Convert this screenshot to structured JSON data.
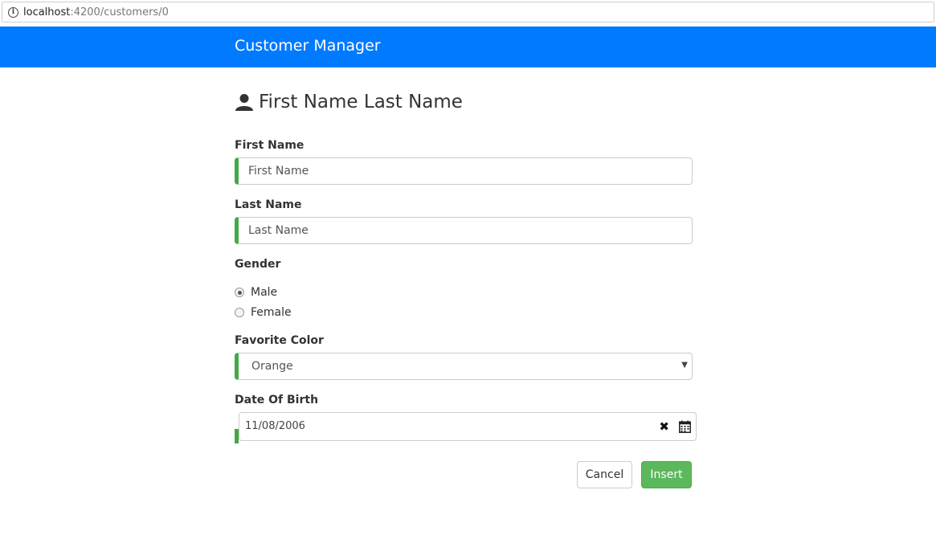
{
  "browser": {
    "url_host": "localhost",
    "url_rest": ":4200/customers/0"
  },
  "navbar": {
    "brand": "Customer Manager",
    "color": "#007bff"
  },
  "form": {
    "heading": "First Name Last Name",
    "first_name": {
      "label": "First Name",
      "value": "",
      "placeholder": "First Name"
    },
    "last_name": {
      "label": "Last Name",
      "value": "",
      "placeholder": "Last Name"
    },
    "gender": {
      "label": "Gender",
      "options": [
        {
          "label": "Male",
          "checked": true
        },
        {
          "label": "Female",
          "checked": false
        }
      ]
    },
    "favorite_color": {
      "label": "Favorite Color",
      "selected": "Orange"
    },
    "date_of_birth": {
      "label": "Date Of Birth",
      "value": "11/08/2006"
    },
    "buttons": {
      "cancel": "Cancel",
      "insert": "Insert"
    },
    "valid_color": "#42a948"
  },
  "icons": {
    "info": "info-icon",
    "user": "user-icon",
    "clear": "clear-icon",
    "calendar": "calendar-icon",
    "dropdown": "chevron-down-icon"
  }
}
